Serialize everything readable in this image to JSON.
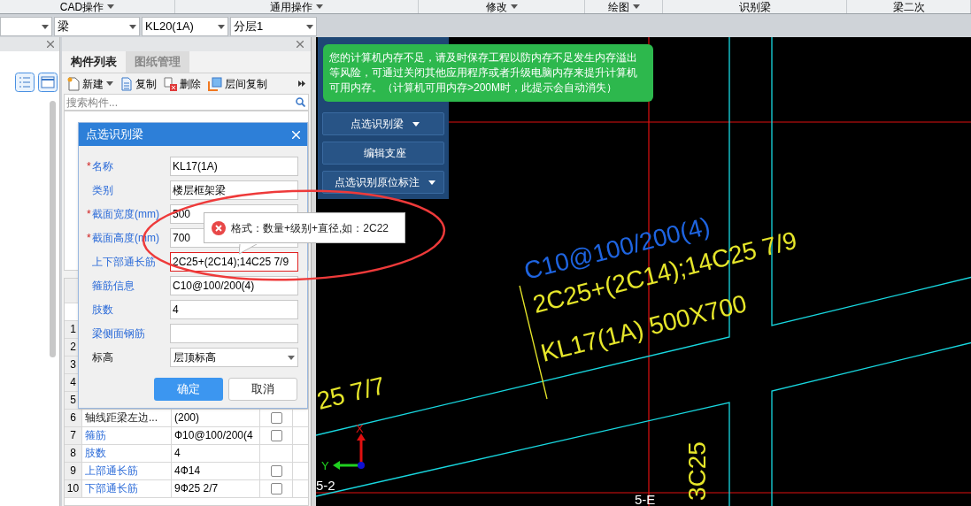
{
  "ribbon": {
    "groups": [
      {
        "label": "CAD操作",
        "dropdown": true
      },
      {
        "label": "通用操作",
        "dropdown": true
      },
      {
        "label": "修改",
        "dropdown": true
      },
      {
        "label": "绘图",
        "dropdown": true
      },
      {
        "label": "识别梁",
        "dropdown": false
      },
      {
        "label": "梁二次",
        "dropdown": false
      }
    ]
  },
  "selectors": [
    {
      "dropdown": true
    },
    {
      "value": "梁",
      "dropdown": true
    },
    {
      "value": "KL20(1A)",
      "dropdown": true
    },
    {
      "value": "分层1",
      "dropdown": true
    }
  ],
  "component_panel": {
    "tabs": [
      {
        "label": "构件列表",
        "selected": true
      },
      {
        "label": "图纸管理",
        "selected": false
      }
    ],
    "toolbar": [
      {
        "kind": "new",
        "label": "新建",
        "dropdown": true
      },
      {
        "kind": "copy",
        "label": "复制",
        "dropdown": false
      },
      {
        "kind": "delete",
        "label": "删除",
        "dropdown": false
      },
      {
        "kind": "layer-copy",
        "label": "层间复制",
        "dropdown": false
      }
    ],
    "search": {
      "placeholder": "搜索构件..."
    },
    "rows": [
      {
        "number": "1"
      },
      {
        "number": "2"
      },
      {
        "number": "3"
      },
      {
        "number": "4"
      },
      {
        "number": "5"
      },
      {
        "number": "6",
        "name": "轴线距梁左边...",
        "value": "(200)",
        "linked": false,
        "checked": false
      },
      {
        "number": "7",
        "name": "箍筋",
        "value": "Ф10@100/200(4",
        "linked": true,
        "checked": false
      },
      {
        "number": "8",
        "name": "肢数",
        "value": "4",
        "linked": true
      },
      {
        "number": "9",
        "name": "上部通长筋",
        "value": "4Ф14",
        "linked": true,
        "checked": false
      },
      {
        "number": "10",
        "name": "下部通长筋",
        "value": "9Ф25 2/7",
        "linked": true,
        "checked": false
      }
    ]
  },
  "tool_panel": {
    "buttons": [
      {
        "label": "点选识别梁",
        "dropdown": true
      },
      {
        "label": "编辑支座",
        "dropdown": false
      },
      {
        "label": "点选识别原位标注",
        "dropdown": true
      }
    ]
  },
  "notification": {
    "text": "您的计算机内存不足，请及时保存工程以防内存不足发生内存溢出等风险，可通过关闭其他应用程序或者升级电脑内存来提升计算机可用内存。（计算机可用内存>200M时，此提示会自动消失）"
  },
  "dialog": {
    "title": "点选识别梁",
    "fields": [
      {
        "marker": "*",
        "label": "名称",
        "kind": "text",
        "value": "KL17(1A)",
        "error": false,
        "linked": true
      },
      {
        "label": "类别",
        "kind": "text",
        "value": "楼层框架梁",
        "error": false,
        "linked": true
      },
      {
        "marker": "*",
        "label": "截面宽度(mm)",
        "kind": "text",
        "value": "500",
        "error": false,
        "linked": true
      },
      {
        "marker": "*",
        "label": "截面高度(mm)",
        "kind": "text",
        "value": "700",
        "error": false,
        "linked": true
      },
      {
        "label": "上下部通长筋",
        "kind": "text",
        "value": "2C25+(2C14);14C25 7/9",
        "error": true,
        "linked": true
      },
      {
        "label": "箍筋信息",
        "kind": "text",
        "value": "C10@100/200(4)",
        "error": false,
        "linked": true
      },
      {
        "label": "肢数",
        "kind": "text",
        "value": "4",
        "error": false,
        "linked": true
      },
      {
        "label": "梁侧面钢筋",
        "kind": "text",
        "error": false,
        "linked": true
      },
      {
        "label": "标高",
        "kind": "select",
        "value": "层顶标高",
        "linked": false
      }
    ],
    "buttons": [
      {
        "label": "确定",
        "primary": true
      },
      {
        "label": "取消",
        "primary": false
      }
    ],
    "error_tip": "格式：数量+级别+直径,如：2C22"
  },
  "drawing": {
    "annotations": [
      {
        "text": "C10@100/200(4)",
        "kind": "stirrup"
      },
      {
        "text": "2C25+(2C14);14C25 7/9",
        "kind": "rebar"
      },
      {
        "text": "KL17(1A) 500X700",
        "kind": "rebar"
      },
      {
        "text": "25 7/7",
        "kind": "rebar"
      },
      {
        "text": "3C25",
        "kind": "vertical"
      }
    ],
    "axis_labels": [
      "5-2",
      "5-E"
    ],
    "ucs": {
      "x": "X",
      "y": "Y"
    }
  }
}
